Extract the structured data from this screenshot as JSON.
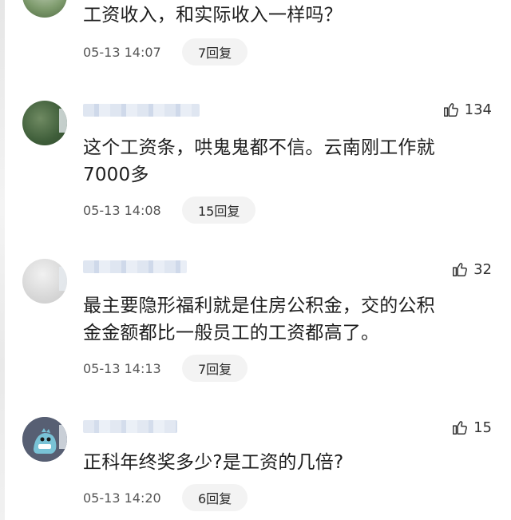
{
  "comments": [
    {
      "text": "工资收入，和实际收入一样吗？",
      "time": "05-13 14:07",
      "reply_label": "7回复",
      "likes": ""
    },
    {
      "text": "这个工资条，哄鬼鬼都不信。云南刚工作就\n7000多",
      "time": "05-13 14:08",
      "reply_label": "15回复",
      "likes": "134"
    },
    {
      "text": "最主要隐形福利就是住房公积金，交的公积\n金金额都比一般员工的工资都高了。",
      "time": "05-13 14:13",
      "reply_label": "7回复",
      "likes": "32"
    },
    {
      "text": "正科年终奖多少?是工资的几倍?",
      "time": "05-13 14:20",
      "reply_label": "6回复",
      "likes": "15"
    }
  ],
  "icons": {
    "like": "thumbs-up-icon"
  },
  "colors": {
    "text": "#1e1e1e",
    "meta": "#555555",
    "reply_bg": "#f3f3f3"
  }
}
